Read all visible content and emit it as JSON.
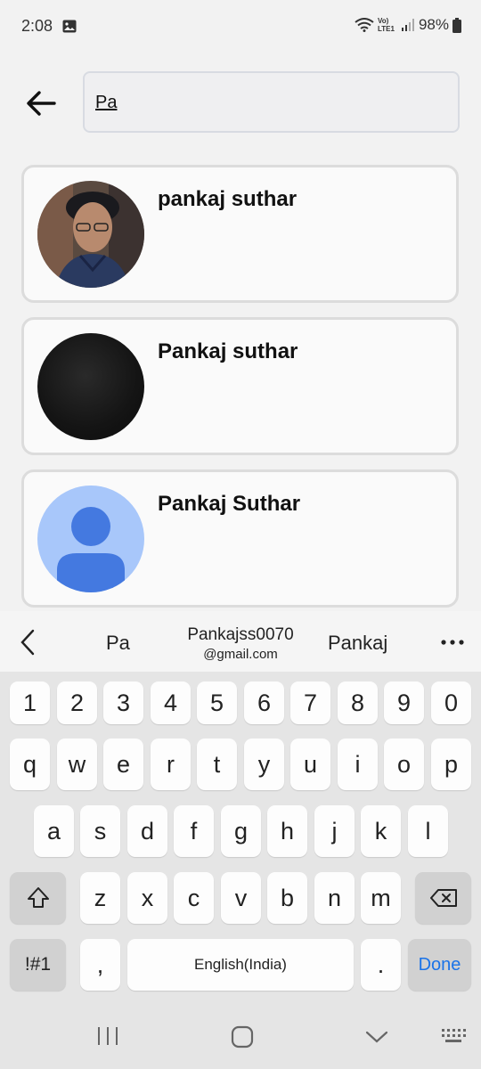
{
  "status": {
    "time": "2:08",
    "battery": "98%",
    "network": "Vo) LTE1"
  },
  "search": {
    "value": "Pa"
  },
  "results": [
    {
      "name": "pankaj suthar",
      "avatar": "photo"
    },
    {
      "name": "Pankaj suthar",
      "avatar": "dark"
    },
    {
      "name": "Pankaj Suthar",
      "avatar": "default-person"
    }
  ],
  "suggestions": {
    "s1": "Pa",
    "s2_line1": "Pankajss0070",
    "s2_line2": "@gmail.com",
    "s3": "Pankaj"
  },
  "keyboard": {
    "row_numbers": [
      "1",
      "2",
      "3",
      "4",
      "5",
      "6",
      "7",
      "8",
      "9",
      "0"
    ],
    "row1": [
      "q",
      "w",
      "e",
      "r",
      "t",
      "y",
      "u",
      "i",
      "o",
      "p"
    ],
    "row2": [
      "a",
      "s",
      "d",
      "f",
      "g",
      "h",
      "j",
      "k",
      "l"
    ],
    "row3": [
      "z",
      "x",
      "c",
      "v",
      "b",
      "n",
      "m"
    ],
    "symbols_label": "!#1",
    "comma": ",",
    "space_label": "English(India)",
    "period": ".",
    "done_label": "Done",
    "done_color": "#1a73e8"
  },
  "colors": {
    "accent_blue": "#1a73e8",
    "avatar_default_bg": "#a8c7fa",
    "avatar_default_fg": "#4479e0"
  }
}
